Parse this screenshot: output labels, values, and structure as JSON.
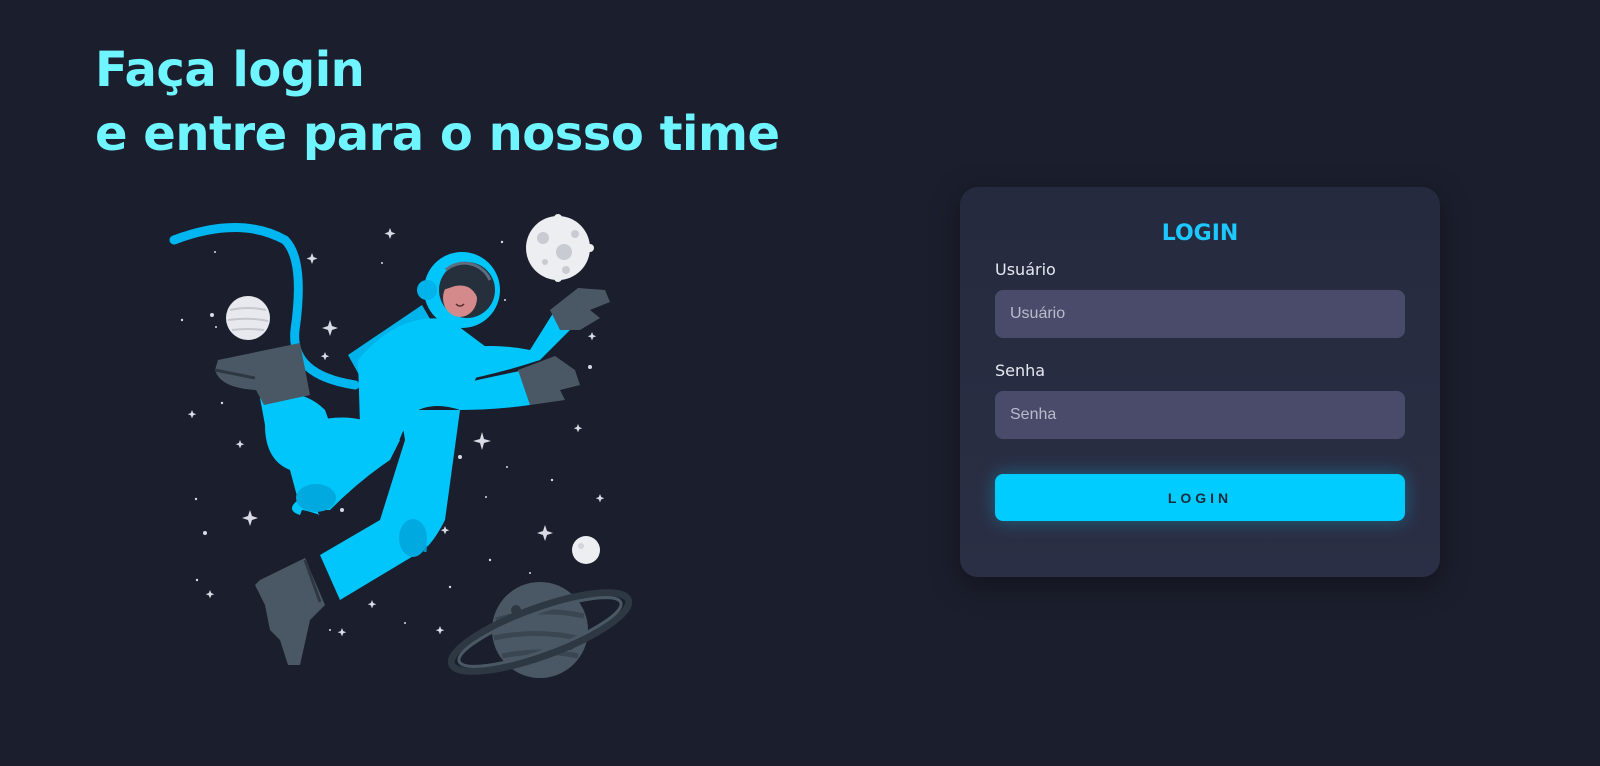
{
  "hero": {
    "line1": "Faça login",
    "line2": "e entre para o nosso time"
  },
  "illustration": {
    "icon": "astronaut-space-illustration"
  },
  "login_card": {
    "title": "LOGIN",
    "username": {
      "label": "Usuário",
      "placeholder": "Usuário",
      "value": ""
    },
    "password": {
      "label": "Senha",
      "placeholder": "Senha",
      "value": ""
    },
    "submit_label": "LOGIN"
  },
  "colors": {
    "background": "#1b1e2c",
    "headline": "#6ff5ff",
    "accent": "#00ccff",
    "card": "#272b3f",
    "input": "#4a4b6a",
    "suit": "#00c8ff",
    "gear": "#4a5866"
  }
}
